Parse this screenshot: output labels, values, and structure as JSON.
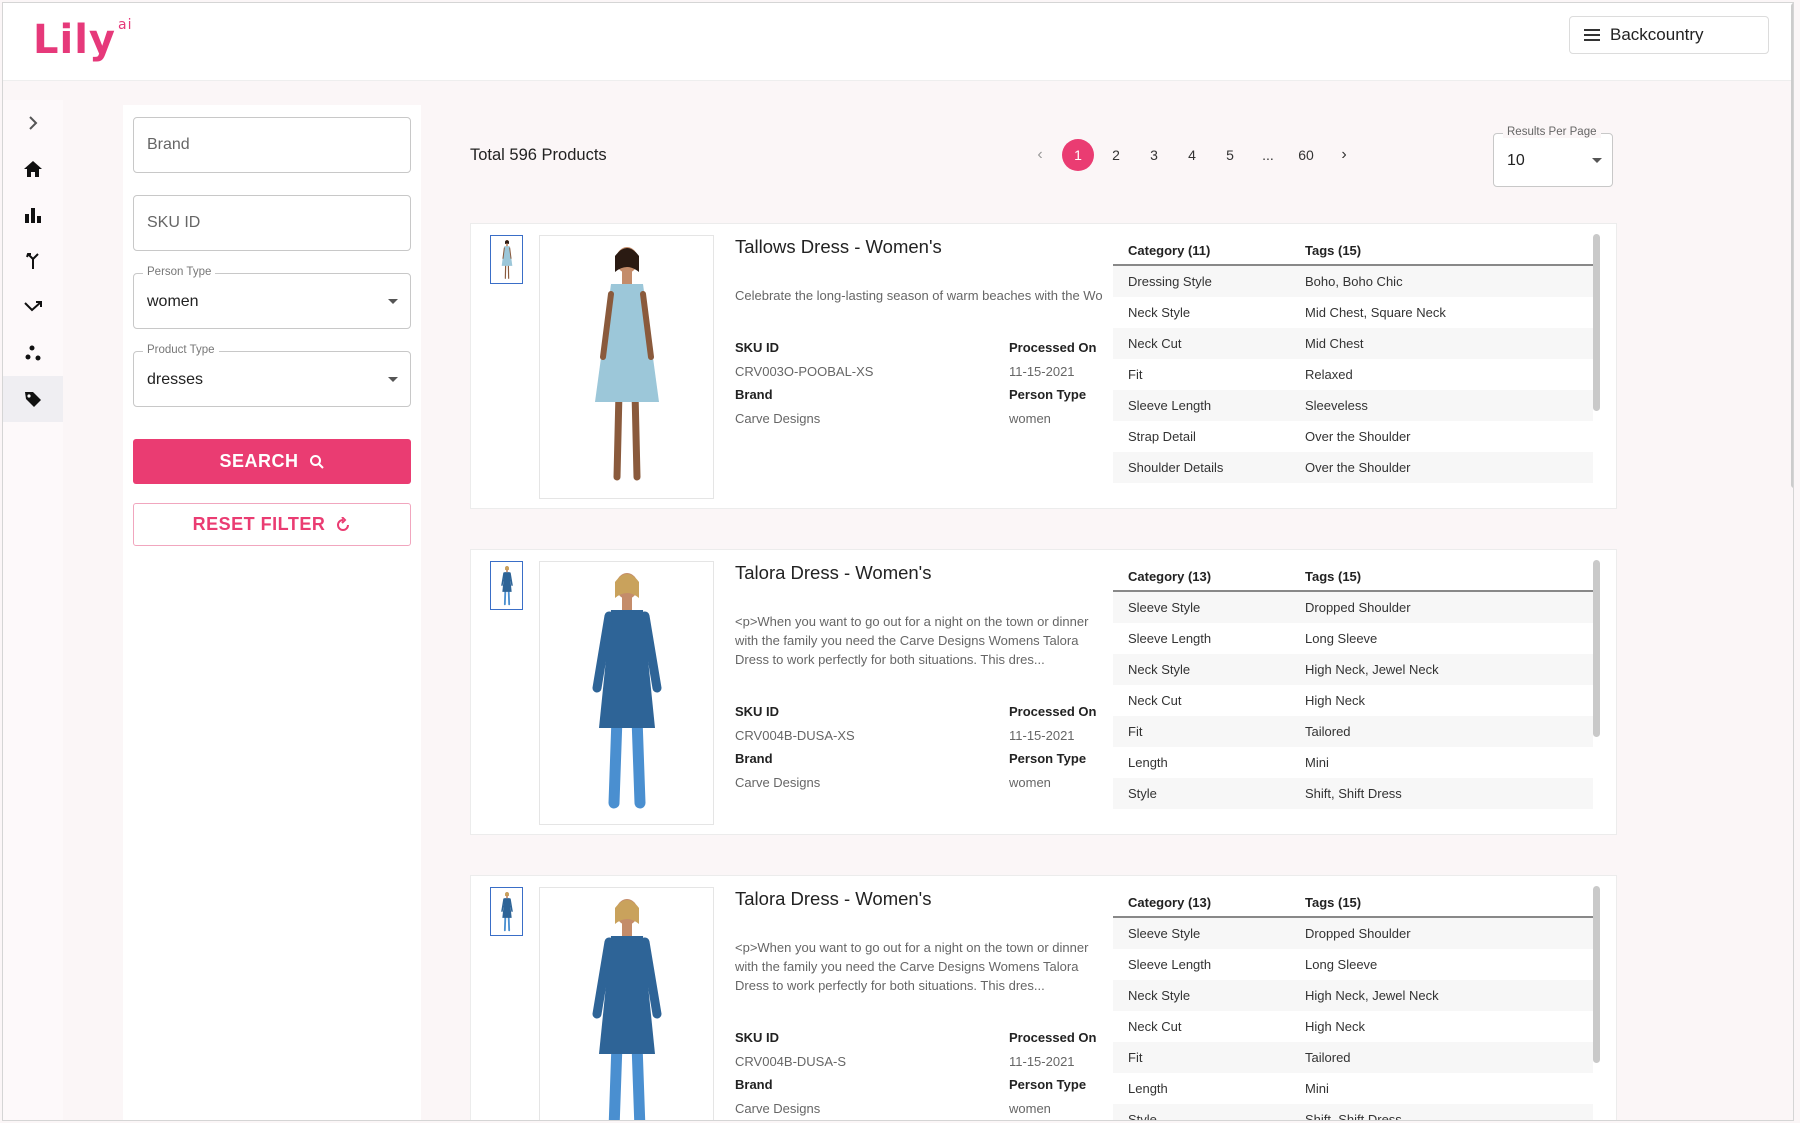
{
  "app": {
    "logo_text": "Lily",
    "logo_sup": "ai",
    "account_label": "Backcountry"
  },
  "nav": [
    {
      "name": "expand-icon"
    },
    {
      "name": "home-icon"
    },
    {
      "name": "bar-chart-icon"
    },
    {
      "name": "merge-icon"
    },
    {
      "name": "trending-icon"
    },
    {
      "name": "scatter-icon"
    },
    {
      "name": "tag-icon"
    }
  ],
  "filters": {
    "brand_placeholder": "Brand",
    "sku_placeholder": "SKU ID",
    "person_type_label": "Person Type",
    "person_type_value": "women",
    "product_type_label": "Product Type",
    "product_type_value": "dresses",
    "search_label": "SEARCH",
    "reset_label": "RESET FILTER"
  },
  "results": {
    "total_label": "Total 596 Products",
    "pages": [
      "1",
      "2",
      "3",
      "4",
      "5",
      "...",
      "60"
    ],
    "current_page": "1",
    "rpp_label": "Results Per Page",
    "rpp_value": "10"
  },
  "labels": {
    "sku": "SKU ID",
    "processed": "Processed On",
    "brand": "Brand",
    "person": "Person Type",
    "category": "Category",
    "tags": "Tags"
  },
  "products": [
    {
      "title": "Tallows Dress - Women's",
      "description": "Celebrate the long-lasting season of warm beaches with the Wo",
      "sku": "CRV003O-POOBAL-XS",
      "processed_on": "11-15-2021",
      "brand": "Carve Designs",
      "person_type": "women",
      "category_header": "Category (11)",
      "tags_header": "Tags (15)",
      "dress_color": "#9cc7d9",
      "attributes": [
        [
          "Dressing Style",
          "Boho, Boho Chic"
        ],
        [
          "Neck Style",
          "Mid Chest, Square Neck"
        ],
        [
          "Neck Cut",
          "Mid Chest"
        ],
        [
          "Fit",
          "Relaxed"
        ],
        [
          "Sleeve Length",
          "Sleeveless"
        ],
        [
          "Strap Detail",
          "Over the Shoulder"
        ],
        [
          "Shoulder Details",
          "Over the Shoulder"
        ]
      ]
    },
    {
      "title": "Talora Dress - Women's",
      "description": "<p>When you want to go out for a night on the town or dinner with the family you need the Carve Designs Womens Talora Dress to work perfectly for both situations. This dres...",
      "sku": "CRV004B-DUSA-XS",
      "processed_on": "11-15-2021",
      "brand": "Carve Designs",
      "person_type": "women",
      "category_header": "Category (13)",
      "tags_header": "Tags (15)",
      "dress_color": "#2e6497",
      "attributes": [
        [
          "Sleeve Style",
          "Dropped Shoulder"
        ],
        [
          "Sleeve Length",
          "Long Sleeve"
        ],
        [
          "Neck Style",
          "High Neck, Jewel Neck"
        ],
        [
          "Neck Cut",
          "High Neck"
        ],
        [
          "Fit",
          "Tailored"
        ],
        [
          "Length",
          "Mini"
        ],
        [
          "Style",
          "Shift, Shift Dress"
        ]
      ]
    },
    {
      "title": "Talora Dress - Women's",
      "description": "<p>When you want to go out for a night on the town or dinner with the family you need the Carve Designs Womens Talora Dress to work perfectly for both situations. This dres...",
      "sku": "CRV004B-DUSA-S",
      "processed_on": "11-15-2021",
      "brand": "Carve Designs",
      "person_type": "women",
      "category_header": "Category (13)",
      "tags_header": "Tags (15)",
      "dress_color": "#2e6497",
      "attributes": [
        [
          "Sleeve Style",
          "Dropped Shoulder"
        ],
        [
          "Sleeve Length",
          "Long Sleeve"
        ],
        [
          "Neck Style",
          "High Neck, Jewel Neck"
        ],
        [
          "Neck Cut",
          "High Neck"
        ],
        [
          "Fit",
          "Tailored"
        ],
        [
          "Length",
          "Mini"
        ],
        [
          "Style",
          "Shift, Shift Dress"
        ]
      ]
    }
  ],
  "colors": {
    "accent": "#ea3c72"
  }
}
